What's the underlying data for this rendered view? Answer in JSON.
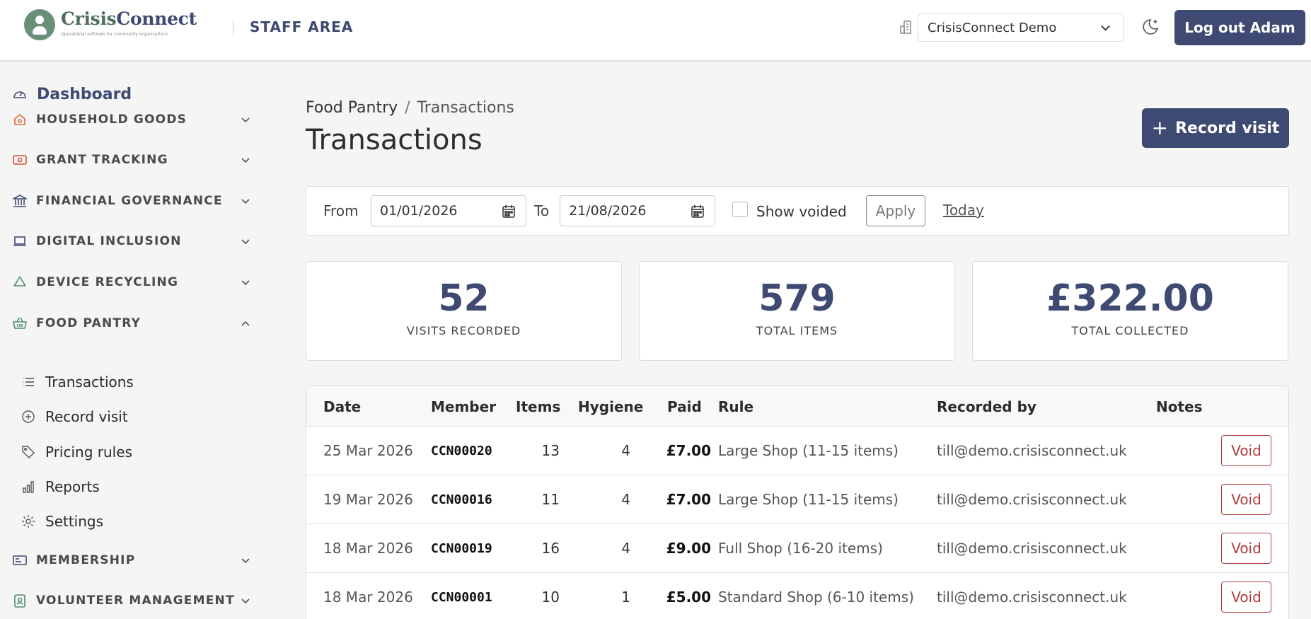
{
  "header": {
    "logo_name_part1": "Crisis",
    "logo_name_part2": "Connect",
    "logo_tagline": "Operational software for community organisations",
    "area_label": "STAFF AREA",
    "org_selected": "CrisisConnect Demo",
    "logout_label": "Log out Adam"
  },
  "sidebar": {
    "dashboard_label": "Dashboard",
    "sections": [
      {
        "label": "HOUSEHOLD GOODS",
        "icon": "house-icon"
      },
      {
        "label": "GRANT TRACKING",
        "icon": "money-icon"
      },
      {
        "label": "FINANCIAL GOVERNANCE",
        "icon": "bank-icon"
      },
      {
        "label": "DIGITAL INCLUSION",
        "icon": "laptop-icon"
      },
      {
        "label": "DEVICE RECYCLING",
        "icon": "recycle-icon"
      },
      {
        "label": "FOOD PANTRY",
        "icon": "basket-icon"
      }
    ],
    "food_pantry_items": [
      {
        "label": "Transactions",
        "icon": "list-icon"
      },
      {
        "label": "Record visit",
        "icon": "plus-circle-icon"
      },
      {
        "label": "Pricing rules",
        "icon": "tag-icon"
      },
      {
        "label": "Reports",
        "icon": "bar-chart-icon"
      },
      {
        "label": "Settings",
        "icon": "gear-icon"
      }
    ],
    "sections_after": [
      {
        "label": "MEMBERSHIP",
        "icon": "id-card-icon"
      },
      {
        "label": "VOLUNTEER MANAGEMENT",
        "icon": "badge-icon"
      }
    ]
  },
  "breadcrumb": {
    "parent": "Food Pantry",
    "separator": "/",
    "current": "Transactions"
  },
  "page_title": "Transactions",
  "record_button_label": "Record visit",
  "filters": {
    "from_label": "From",
    "from_value": "01/01/2026",
    "to_label": "To",
    "to_value": "21/08/2026",
    "show_voided_label": "Show voided",
    "apply_label": "Apply",
    "today_label": "Today"
  },
  "stats": [
    {
      "value": "52",
      "label": "VISITS RECORDED"
    },
    {
      "value": "579",
      "label": "TOTAL ITEMS"
    },
    {
      "value": "£322.00",
      "label": "TOTAL COLLECTED"
    }
  ],
  "table": {
    "headers": {
      "date": "Date",
      "member": "Member",
      "items": "Items",
      "hygiene": "Hygiene",
      "paid": "Paid",
      "rule": "Rule",
      "recorded_by": "Recorded by",
      "notes": "Notes"
    },
    "void_label": "Void",
    "rows": [
      {
        "date": "25 Mar 2026",
        "member": "CCN00020",
        "items": "13",
        "hygiene": "4",
        "paid": "£7.00",
        "rule": "Large Shop (11-15 items)",
        "recorded_by": "till@demo.crisisconnect.uk"
      },
      {
        "date": "19 Mar 2026",
        "member": "CCN00016",
        "items": "11",
        "hygiene": "4",
        "paid": "£7.00",
        "rule": "Large Shop (11-15 items)",
        "recorded_by": "till@demo.crisisconnect.uk"
      },
      {
        "date": "18 Mar 2026",
        "member": "CCN00019",
        "items": "16",
        "hygiene": "4",
        "paid": "£9.00",
        "rule": "Full Shop (16-20 items)",
        "recorded_by": "till@demo.crisisconnect.uk"
      },
      {
        "date": "18 Mar 2026",
        "member": "CCN00001",
        "items": "10",
        "hygiene": "1",
        "paid": "£5.00",
        "rule": "Standard Shop (6-10 items)",
        "recorded_by": "till@demo.crisisconnect.uk"
      }
    ]
  },
  "colors": {
    "brand_navy": "#3e4a72",
    "brand_green": "#4e6f5b",
    "void_red": "#b23b3b"
  }
}
